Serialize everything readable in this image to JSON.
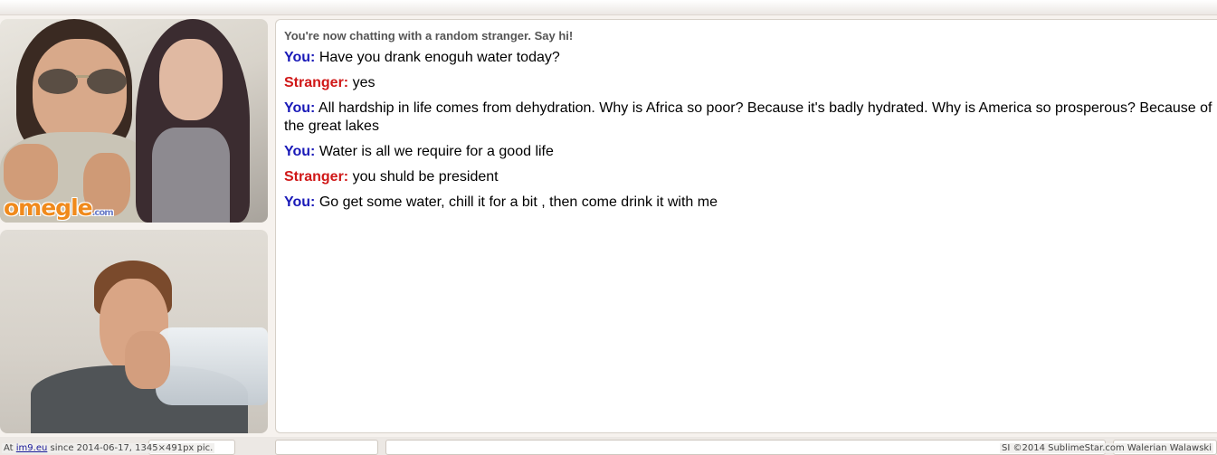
{
  "app": {
    "logo_text": "omegle",
    "logo_suffix": ".com"
  },
  "chat": {
    "status": "You're now chatting with a random stranger. Say hi!",
    "messages": [
      {
        "sender": "You:",
        "text": "Have you drank enoguh water today?"
      },
      {
        "sender": "Stranger:",
        "text": "yes"
      },
      {
        "sender": "You:",
        "text": "All hardship in life comes from dehydration. Why is Africa so poor? Because it's badly hydrated. Why is America so prosperous? Because of the great lakes"
      },
      {
        "sender": "You:",
        "text": "Water is all we require for a good life"
      },
      {
        "sender": "Stranger:",
        "text": "you shuld be president"
      },
      {
        "sender": "You:",
        "text": "Go get some water, chill it for a bit , then come drink it with me"
      }
    ],
    "colors": {
      "you": "#1a1ab8",
      "stranger": "#d01818"
    }
  },
  "footer": {
    "left_prefix": "At",
    "left_link": "im9.eu",
    "left_suffix": "since 2014-06-17, 1345×491px pic.",
    "right": "SI ©2014 SublimeStar.com Walerian Walawski"
  }
}
